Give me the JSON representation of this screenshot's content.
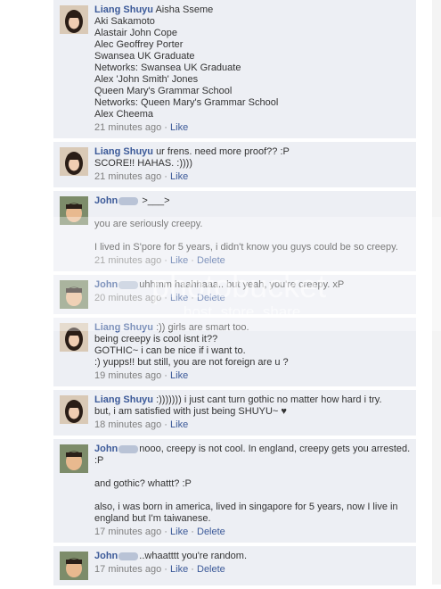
{
  "comments": [
    {
      "author": "Liang Shuyu",
      "lines": [
        "Aisha Sseme",
        "Aki Sakamoto",
        "Alastair John Cope",
        "Alec Geoffrey Porter",
        "Swansea UK Graduate",
        "Networks: Swansea UK Graduate",
        "Alex 'John Smith' Jones",
        "Queen Mary's Grammar School",
        "Networks: Queen Mary's Grammar School",
        "Alex Cheema"
      ],
      "time": "21 minutes ago",
      "like": "Like"
    },
    {
      "author": "Liang Shuyu",
      "lines": [
        "ur frens. need more proof?? :P",
        "SCORE!! HAHAS. :))))"
      ],
      "time": "21 minutes ago",
      "like": "Like"
    },
    {
      "author": "John",
      "lines": [
        ">___>",
        "",
        "you are seriously creepy.",
        "",
        "I lived in S'pore for 5 years, i didn't know you guys could be so creepy."
      ],
      "time": "21 minutes ago",
      "like": "Like",
      "delete": "Delete"
    },
    {
      "author": "John",
      "lines": [
        "uhhmm haahhaaa.. but yeah, you're creepy. xP"
      ],
      "time": "20 minutes ago",
      "like": "Like",
      "delete": "Delete"
    },
    {
      "author": "Liang Shuyu",
      "lines": [
        ":)) girls are smart too.",
        "being creepy is cool isnt it??",
        "GOTHIC~ i can be nice if i want to.",
        ":) yupps!! but still, you are not foreign are u ?"
      ],
      "time": "19 minutes ago",
      "like": "Like"
    },
    {
      "author": "Liang Shuyu",
      "lines": [
        ":))))))) i just cant turn gothic no matter how hard i try.",
        "but, i am satisfied with just being SHUYU~ ♥"
      ],
      "time": "18 minutes ago",
      "like": "Like"
    },
    {
      "author": "John",
      "lines": [
        "nooo, creepy is not cool. In england, creepy gets you arrested.",
        ":P",
        "",
        "and gothic? whattt? :P",
        "",
        "also, i was born in america, lived in singapore for 5 years, now I live in",
        "england but I'm taiwanese."
      ],
      "time": "17 minutes ago",
      "like": "Like",
      "delete": "Delete"
    },
    {
      "author": "John",
      "lines": [
        "..whaatttt you're random."
      ],
      "time": "17 minutes ago",
      "like": "Like",
      "delete": "Delete"
    }
  ],
  "separator": "·",
  "watermark": {
    "main": "photobucket",
    "sub": "host. store. share."
  },
  "colors": {
    "link": "#3b5998",
    "comment_bg": "#edeff4",
    "meta": "#808080"
  }
}
